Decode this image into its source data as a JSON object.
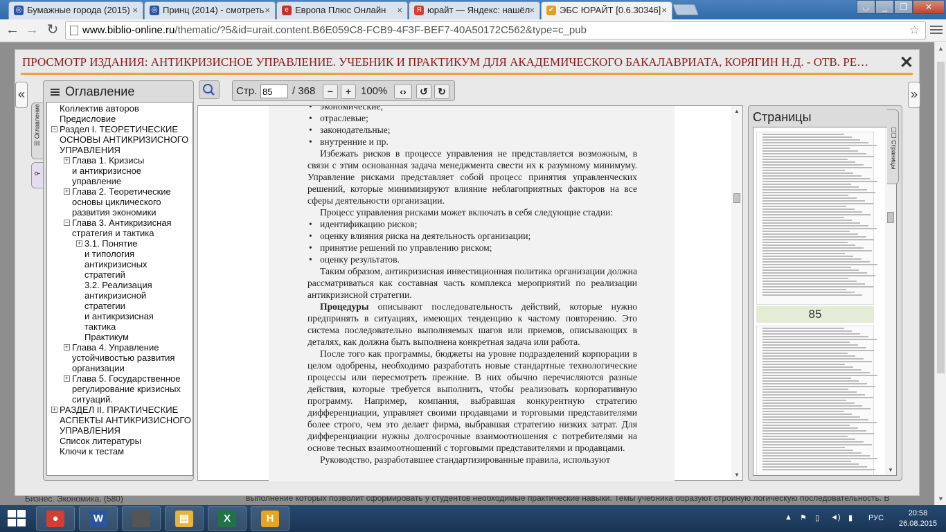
{
  "browser": {
    "tabs": [
      {
        "label": "Бумажные города (2015)",
        "fav_color": "#2a55a0",
        "fav_glyph": "◎"
      },
      {
        "label": "Принц (2014) - смотреть",
        "fav_color": "#2a55a0",
        "fav_glyph": "◎"
      },
      {
        "label": "Европа Плюс Онлайн",
        "fav_color": "#c83030",
        "fav_glyph": "e"
      },
      {
        "label": "юрайт — Яндекс: нашёл",
        "fav_color": "#e03a2a",
        "fav_glyph": "Я"
      },
      {
        "label": "ЭБС ЮРАЙТ [0.6.30346]",
        "fav_color": "#e6a020",
        "fav_glyph": "✔"
      }
    ],
    "url_host": "www.biblio-online.ru",
    "url_rest": "/thematic/?5&id=urait.content.B6E059C8-FCB9-4F3F-BEF7-40A50172C562&type=c_pub"
  },
  "viewer": {
    "title": "ПРОСМОТР ИЗДАНИЯ: АНТИКРИЗИСНОЕ УПРАВЛЕНИЕ. УЧЕБНИК И ПРАКТИКУМ ДЛЯ АКАДЕМИЧЕСКОГО БАКАЛАВРИАТА, КОРЯГИН Н.Д. - ОТВ. РЕ…",
    "close": "✕",
    "left_arrow": "«",
    "right_arrow": "»",
    "toc_tab": "☰ Оглавление",
    "pages_tab": "☐☐ Страницы"
  },
  "toc": {
    "heading": "Оглавление",
    "items": [
      {
        "text": "Коллектив авторов",
        "indent": 0,
        "pm": ""
      },
      {
        "text": "Предисловие",
        "indent": 0,
        "pm": ""
      },
      {
        "text": "Раздел I. ТЕОРЕТИЧЕСКИЕ\nОСНОВЫ АНТИКРИЗИСНОГО\nУПРАВЛЕНИЯ",
        "indent": 0,
        "pm": "−"
      },
      {
        "text": "Глава 1. Кризисы\nи антикризисное\nуправление",
        "indent": 1,
        "pm": "+"
      },
      {
        "text": "Глава 2. Теоретические\nосновы циклического\nразвития экономики",
        "indent": 1,
        "pm": "+"
      },
      {
        "text": "Глава 3. Антикризисная\nстратегия и тактика",
        "indent": 1,
        "pm": "−"
      },
      {
        "text": "3.1. Понятие\nи типология\nантикризисных\nстратегий",
        "indent": 2,
        "pm": "+"
      },
      {
        "text": "3.2. Реализация\nантикризисной\nстратегии\nи антикризисная\nтактика",
        "indent": 2,
        "pm": ""
      },
      {
        "text": "Практикум",
        "indent": 2,
        "pm": ""
      },
      {
        "text": "Глава 4. Управление\nустойчивостью развития\nорганизации",
        "indent": 1,
        "pm": "+"
      },
      {
        "text": "Глава 5. Государственное\nрегулирование кризисных\nситуаций.",
        "indent": 1,
        "pm": "+"
      },
      {
        "text": "РАЗДЕЛ II. ПРАКТИЧЕСКИЕ\nАСПЕКТЫ АНТИКРИЗИСНОГО\nУПРАВЛЕНИЯ",
        "indent": 0,
        "pm": "+"
      },
      {
        "text": "Список литературы",
        "indent": 0,
        "pm": ""
      },
      {
        "text": "Ключи к тестам",
        "indent": 0,
        "pm": ""
      }
    ]
  },
  "toolbar": {
    "page_label": "Стр.",
    "page_value": "85",
    "page_total": "/ 368",
    "zoom": "100%",
    "zoom_out": "−",
    "zoom_in": "+",
    "fit": "‹›",
    "rotate_left": "↺",
    "rotate_right": "↻"
  },
  "document": {
    "bullets_top": [
      "экономические;",
      "отраслевые;",
      "законодательные;",
      "внутренние и пр."
    ],
    "p1": "Избежать рисков в процессе управления не представляется возможным, в связи с этим основанная задача менеджмента свести их к разумному минимуму. Управление рисками представляет собой процесс принятия управленческих решений, которые минимизируют влияние неблагоприятных факторов на все сферы деятельности организации.",
    "p2": "Процесс управления рисками может включать в себя следующие стадии:",
    "bullets_mid": [
      "идентификацию рисков;",
      "оценку влияния риска на деятельность организации;",
      "принятие решений по управлению риском;",
      "оценку результатов."
    ],
    "p3": "Таким образом, антикризисная инвестиционная политика организации должна рассматриваться как составная часть комплекса мероприятий по реализации антикризисной стратегии.",
    "p4_bold": "Процедуры",
    "p4": " описывают последовательность действий, которые нужно предпринять в ситуациях, имеющих тенденцию к частому повторению. Это система последовательно выполняемых шагов или приемов, описывающих в деталях, как должна быть выполнена конкретная задача или работа.",
    "p5": "После того как программы, бюджеты на уровне подразделений корпорации в целом одобрены, необходимо разработать новые стандартные технологические процессы или пересмотреть прежние. В них обычно перечисляются разные действия, которые требуется выполнить, чтобы реализовать корпоративную программу. Например, компания, выбравшая конкурентную стратегию дифференциации, управляет своими продавцами и торговыми представителями более строго, чем это делает фирма, выбравшая стратегию низких затрат. Для дифференциации нужны долгосрочные взаимоотношения с потребителями на основе тесных взаимоотношений с торговыми представителями и продавцами.",
    "p6": "Руководство, разработавшее стандартизированные правила, используют"
  },
  "pages_panel": {
    "heading": "Страницы",
    "current_page": "85"
  },
  "background": {
    "left_text": "Бизнес. Экономика. (580)",
    "bottom_text": "выполнение которых позволит сформировать у студентов необходимые практические навыки. Темы учебника образуют стройную логическую последовательность. В"
  },
  "taskbar": {
    "lang": "РУС",
    "time": "20:58",
    "date": "26.08.2015",
    "apps": [
      {
        "name": "chrome",
        "glyph": "●",
        "color": "#d23f31"
      },
      {
        "name": "word",
        "glyph": "W",
        "color": "#2b579a"
      },
      {
        "name": "blank",
        "glyph": "",
        "color": "#555"
      },
      {
        "name": "explorer",
        "glyph": "▤",
        "color": "#e8b43c"
      },
      {
        "name": "excel",
        "glyph": "X",
        "color": "#217346"
      },
      {
        "name": "h-app",
        "glyph": "H",
        "color": "#e8a41c"
      }
    ]
  }
}
